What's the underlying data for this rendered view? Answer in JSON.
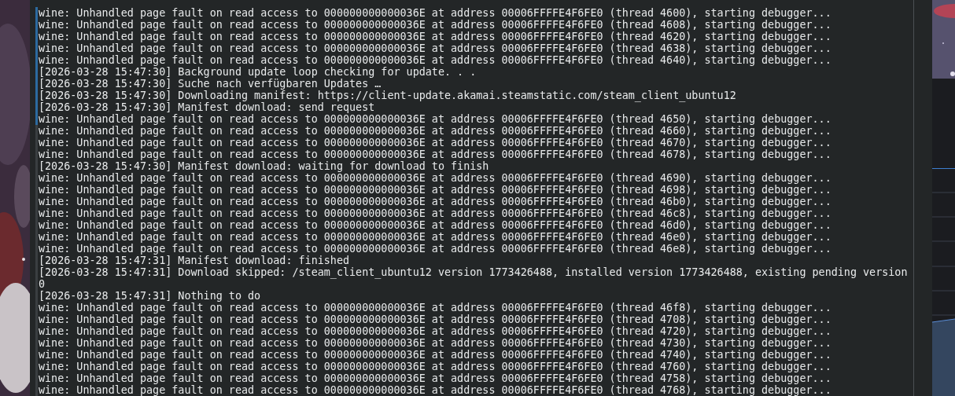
{
  "terminal": {
    "lines": [
      {
        "text": "wine: Unhandled page fault on read access to 000000000000036E at address 00006FFFFE4F6FE0 (thread 4600), starting debugger...",
        "marked": true
      },
      {
        "text": "wine: Unhandled page fault on read access to 000000000000036E at address 00006FFFFE4F6FE0 (thread 4608), starting debugger...",
        "marked": true
      },
      {
        "text": "wine: Unhandled page fault on read access to 000000000000036E at address 00006FFFFE4F6FE0 (thread 4620), starting debugger...",
        "marked": true
      },
      {
        "text": "wine: Unhandled page fault on read access to 000000000000036E at address 00006FFFFE4F6FE0 (thread 4638), starting debugger...",
        "marked": true
      },
      {
        "text": "wine: Unhandled page fault on read access to 000000000000036E at address 00006FFFFE4F6FE0 (thread 4640), starting debugger...",
        "marked": true
      },
      {
        "text": "[2026-03-28 15:47:30] Background update loop checking for update. . .",
        "marked": true
      },
      {
        "text": "[2026-03-28 15:47:30] Suche nach verfügbaren Updates …",
        "marked": true
      },
      {
        "text": "[2026-03-28 15:47:30] Downloading manifest: https://client-update.akamai.steamstatic.com/steam_client_ubuntu12",
        "marked": true
      },
      {
        "text": "[2026-03-28 15:47:30] Manifest download: send request",
        "marked": true
      },
      {
        "text": "wine: Unhandled page fault on read access to 000000000000036E at address 00006FFFFE4F6FE0 (thread 4650), starting debugger...",
        "marked": true
      },
      {
        "text": "wine: Unhandled page fault on read access to 000000000000036E at address 00006FFFFE4F6FE0 (thread 4660), starting debugger...",
        "marked": false
      },
      {
        "text": "wine: Unhandled page fault on read access to 000000000000036E at address 00006FFFFE4F6FE0 (thread 4670), starting debugger...",
        "marked": false
      },
      {
        "text": "wine: Unhandled page fault on read access to 000000000000036E at address 00006FFFFE4F6FE0 (thread 4678), starting debugger...",
        "marked": false
      },
      {
        "text": "[2026-03-28 15:47:30] Manifest download: waiting for download to finish",
        "marked": false
      },
      {
        "text": "wine: Unhandled page fault on read access to 000000000000036E at address 00006FFFFE4F6FE0 (thread 4690), starting debugger...",
        "marked": false
      },
      {
        "text": "wine: Unhandled page fault on read access to 000000000000036E at address 00006FFFFE4F6FE0 (thread 4698), starting debugger...",
        "marked": false
      },
      {
        "text": "wine: Unhandled page fault on read access to 000000000000036E at address 00006FFFFE4F6FE0 (thread 46b0), starting debugger...",
        "marked": false
      },
      {
        "text": "wine: Unhandled page fault on read access to 000000000000036E at address 00006FFFFE4F6FE0 (thread 46c8), starting debugger...",
        "marked": false
      },
      {
        "text": "wine: Unhandled page fault on read access to 000000000000036E at address 00006FFFFE4F6FE0 (thread 46d0), starting debugger...",
        "marked": false
      },
      {
        "text": "wine: Unhandled page fault on read access to 000000000000036E at address 00006FFFFE4F6FE0 (thread 46e0), starting debugger...",
        "marked": false
      },
      {
        "text": "wine: Unhandled page fault on read access to 000000000000036E at address 00006FFFFE4F6FE0 (thread 46e8), starting debugger...",
        "marked": false
      },
      {
        "text": "[2026-03-28 15:47:31] Manifest download: finished",
        "marked": false
      },
      {
        "text": "[2026-03-28 15:47:31] Download skipped: /steam_client_ubuntu12 version 1773426488, installed version 1773426488, existing pending version 0",
        "marked": false
      },
      {
        "text": "[2026-03-28 15:47:31] Nothing to do",
        "marked": false
      },
      {
        "text": "wine: Unhandled page fault on read access to 000000000000036E at address 00006FFFFE4F6FE0 (thread 46f8), starting debugger...",
        "marked": false
      },
      {
        "text": "wine: Unhandled page fault on read access to 000000000000036E at address 00006FFFFE4F6FE0 (thread 4708), starting debugger...",
        "marked": false
      },
      {
        "text": "wine: Unhandled page fault on read access to 000000000000036E at address 00006FFFFE4F6FE0 (thread 4720), starting debugger...",
        "marked": false
      },
      {
        "text": "wine: Unhandled page fault on read access to 000000000000036E at address 00006FFFFE4F6FE0 (thread 4730), starting debugger...",
        "marked": false
      },
      {
        "text": "wine: Unhandled page fault on read access to 000000000000036E at address 00006FFFFE4F6FE0 (thread 4740), starting debugger...",
        "marked": false
      },
      {
        "text": "wine: Unhandled page fault on read access to 000000000000036E at address 00006FFFFE4F6FE0 (thread 4760), starting debugger...",
        "marked": false
      },
      {
        "text": "wine: Unhandled page fault on read access to 000000000000036E at address 00006FFFFE4F6FE0 (thread 4758), starting debugger...",
        "marked": false
      },
      {
        "text": "wine: Unhandled page fault on read access to 000000000000036E at address 00006FFFFE4F6FE0 (thread 4768), starting debugger...",
        "marked": false
      }
    ]
  }
}
